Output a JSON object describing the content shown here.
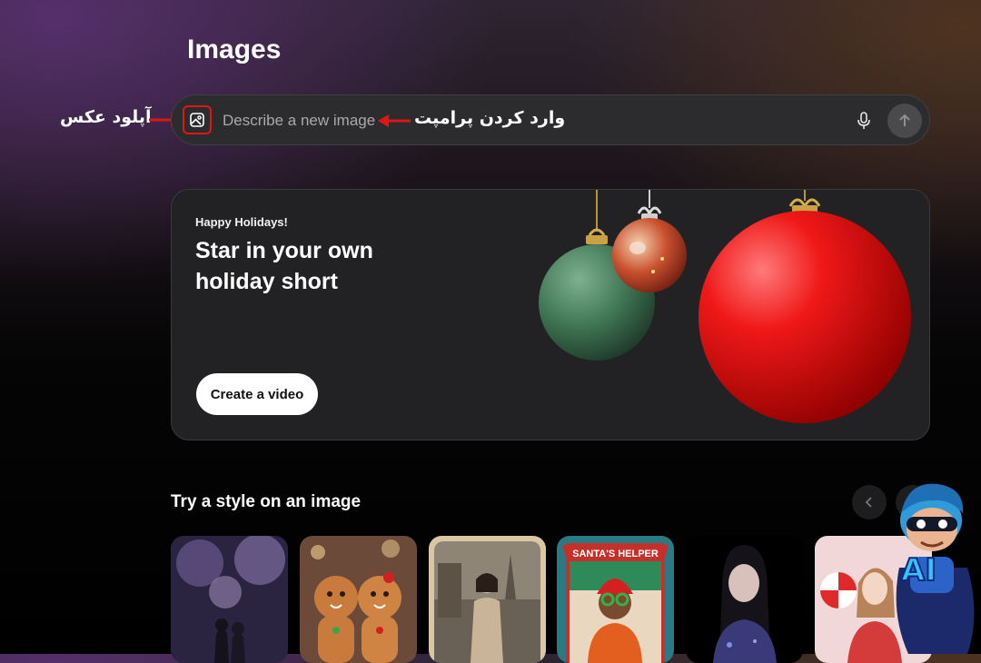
{
  "page": {
    "title": "Images"
  },
  "search": {
    "placeholder": "Describe a new image"
  },
  "annotations": {
    "upload": "آپلود عکس",
    "prompt": "وارد کردن پرامپت"
  },
  "banner": {
    "kicker": "Happy Holidays!",
    "title": "Star in your own holiday short",
    "cta_label": "Create a video"
  },
  "styles_section": {
    "title": "Try a style on an image",
    "thumbnails": [
      {
        "subject": "fireworks couple"
      },
      {
        "subject": "gingerbread cookies"
      },
      {
        "subject": "paris eiffel tower portrait"
      },
      {
        "subject": "santa's helper poster",
        "caption": "SANTA'S HELPER"
      },
      {
        "subject": "glowing portrait"
      },
      {
        "subject": "candy cane portrait"
      }
    ]
  },
  "watermark": {
    "text": "AI"
  },
  "colors": {
    "annotation_red": "#e01515",
    "banner_bg": "#222224",
    "search_bg": "#2c2c2e"
  },
  "icons": [
    "image-upload-icon",
    "microphone-icon",
    "arrow-up-icon",
    "chevron-left-icon",
    "chevron-right-icon"
  ]
}
